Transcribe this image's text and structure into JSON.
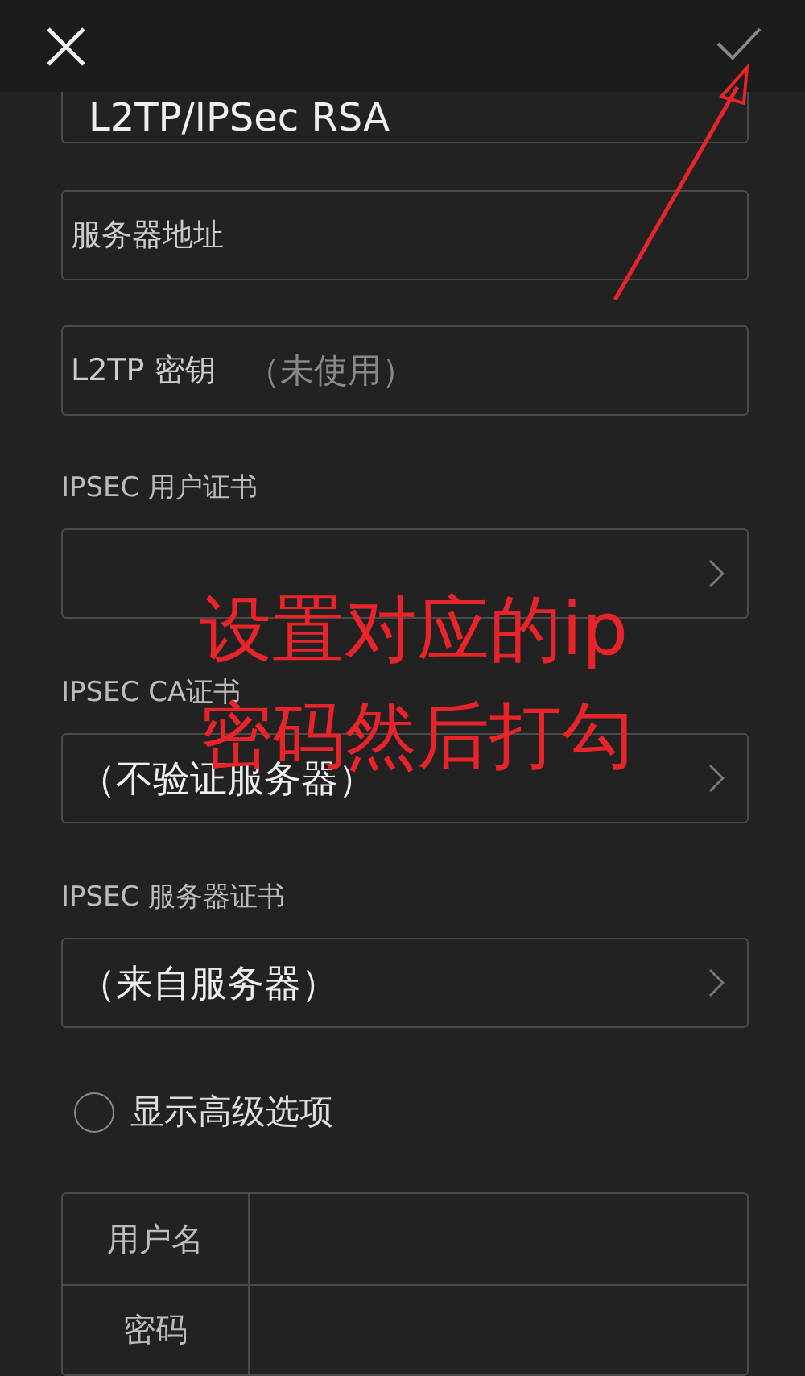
{
  "vpn_type": {
    "value": "L2TP/IPSec RSA"
  },
  "fields": [
    {
      "label": "服务器地址"
    },
    {
      "label": "L2TP 密钥",
      "placeholder": "（未使用）"
    }
  ],
  "cert_sections": [
    {
      "label": "IPSEC 用户证书"
    },
    {
      "label": "IPSEC CA证书",
      "value": "（不验证服务器）"
    },
    {
      "label": "IPSEC 服务器证书",
      "value": "（来自服务器）"
    }
  ],
  "advanced": {
    "label": "显示高级选项",
    "checked": false
  },
  "credentials": [
    {
      "label": "用户名"
    },
    {
      "label": "密码"
    }
  ],
  "annotation": {
    "lines": [
      "设置对应的ip",
      "密码然后打勾"
    ]
  }
}
